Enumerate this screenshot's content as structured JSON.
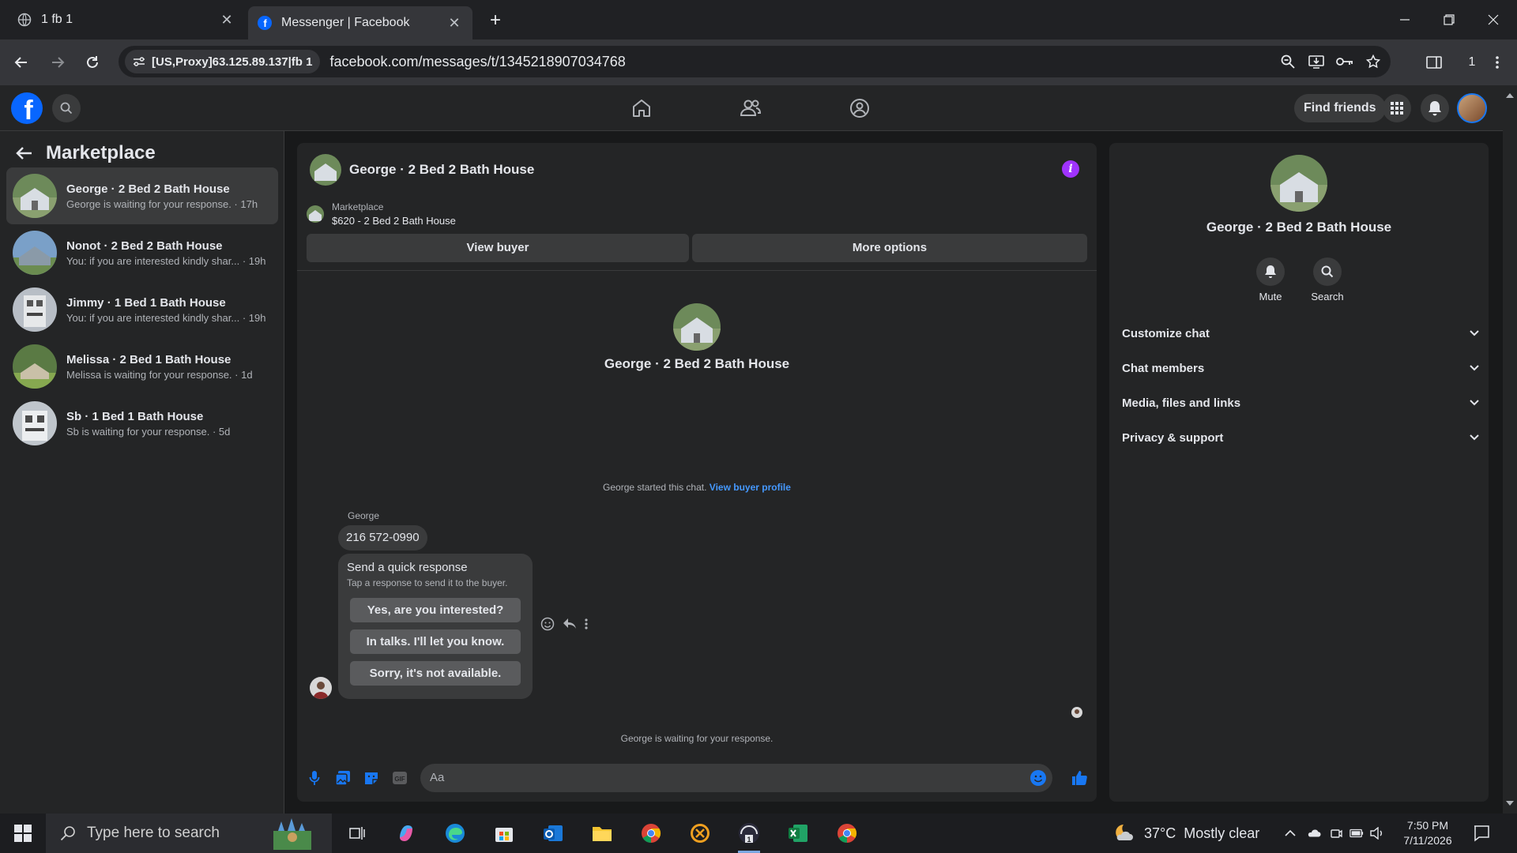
{
  "browser": {
    "tabs": [
      {
        "title": "1 fb 1",
        "active": false
      },
      {
        "title": "Messenger | Facebook",
        "active": true
      }
    ],
    "proxy_chip": "[US,Proxy]63.125.89.137|fb 1",
    "url": "facebook.com/messages/t/1345218907034768",
    "profile_count": "1"
  },
  "fb_header": {
    "find_friends": "Find friends"
  },
  "sidebar": {
    "title": "Marketplace",
    "conversations": [
      {
        "name": "George · 2 Bed 2 Bath House",
        "preview": "George is waiting for your response. · 17h",
        "selected": true
      },
      {
        "name": "Nonot · 2 Bed 2 Bath House",
        "preview": "You: if you are interested kindly shar... · 19h",
        "selected": false
      },
      {
        "name": "Jimmy · 1 Bed 1 Bath House",
        "preview": "You: if you are interested kindly shar... · 19h",
        "selected": false
      },
      {
        "name": "Melissa · 2 Bed 1 Bath House",
        "preview": "Melissa is waiting for your response. · 1d",
        "selected": false
      },
      {
        "name": "Sb · 1 Bed 1 Bath House",
        "preview": "Sb is waiting for your response. · 5d",
        "selected": false
      }
    ]
  },
  "chat": {
    "title": "George · 2 Bed 2 Bath House",
    "info_icon": "i",
    "listing_label": "Marketplace",
    "listing_price": "$620 - 2 Bed 2 Bath House",
    "view_buyer": "View buyer",
    "more_options": "More options",
    "center_name": "George · 2 Bed 2 Bath House",
    "started_text": "George started this chat.",
    "started_link": "View buyer profile",
    "sender": "George",
    "message": "216 572-0990",
    "quick_title": "Send a quick response",
    "quick_sub": "Tap a response to send it to the buyer.",
    "quick_replies": [
      "Yes, are you interested?",
      "In talks. I'll let you know.",
      "Sorry, it's not available."
    ],
    "waiting_text": "George is waiting for your response.",
    "input_placeholder": "Aa",
    "gif_label": "GIF"
  },
  "right_panel": {
    "name": "George · 2 Bed 2 Bath House",
    "actions": [
      "Mute",
      "Search"
    ],
    "sections": [
      "Customize chat",
      "Chat members",
      "Media, files and links",
      "Privacy & support"
    ]
  },
  "taskbar": {
    "search_placeholder": "Type here to search",
    "weather_temp": "37°C",
    "weather_text": "Mostly clear",
    "time": "7:50 PM",
    "date": "7/11/2026"
  },
  "colors": {
    "fb_blue": "#0866ff",
    "accent_link": "#4599ff",
    "info_purple": "#a033ff",
    "panel_bg": "#242526",
    "page_bg": "#18191a"
  }
}
